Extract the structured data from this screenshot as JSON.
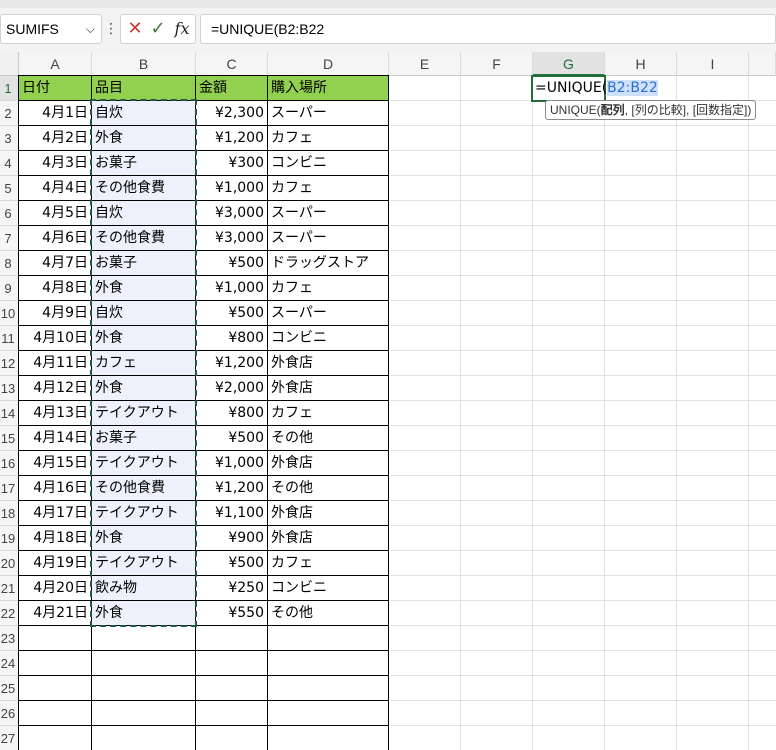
{
  "formula_bar": {
    "name_box": "SUMIFS",
    "name_box_dropdown_icon": "chevron-down-icon",
    "cancel_icon": "✕",
    "enter_icon": "✓",
    "fx_label": "fx",
    "formula": "=UNIQUE(B2:B22"
  },
  "columns": [
    "A",
    "B",
    "C",
    "D",
    "E",
    "F",
    "G",
    "H",
    "I"
  ],
  "active_column": "G",
  "rows": [
    "1",
    "2",
    "3",
    "4",
    "5",
    "6",
    "7",
    "8",
    "9",
    "10",
    "11",
    "12",
    "13",
    "14",
    "15",
    "16",
    "17",
    "18",
    "19",
    "20",
    "21",
    "22",
    "23",
    "24",
    "25",
    "26",
    "27"
  ],
  "active_row": "1",
  "table": {
    "headers": [
      "日付",
      "品目",
      "金額",
      "購入場所"
    ],
    "header_color": "#92d050",
    "rows": [
      [
        "4月1日",
        "自炊",
        "¥2,300",
        "スーパー"
      ],
      [
        "4月2日",
        "外食",
        "¥1,200",
        "カフェ"
      ],
      [
        "4月3日",
        "お菓子",
        "¥300",
        "コンビニ"
      ],
      [
        "4月4日",
        "その他食費",
        "¥1,000",
        "カフェ"
      ],
      [
        "4月5日",
        "自炊",
        "¥3,000",
        "スーパー"
      ],
      [
        "4月6日",
        "その他食費",
        "¥3,000",
        "スーパー"
      ],
      [
        "4月7日",
        "お菓子",
        "¥500",
        "ドラッグストア"
      ],
      [
        "4月8日",
        "外食",
        "¥1,000",
        "カフェ"
      ],
      [
        "4月9日",
        "自炊",
        "¥500",
        "スーパー"
      ],
      [
        "4月10日",
        "外食",
        "¥800",
        "コンビニ"
      ],
      [
        "4月11日",
        "カフェ",
        "¥1,200",
        "外食店"
      ],
      [
        "4月12日",
        "外食",
        "¥2,000",
        "外食店"
      ],
      [
        "4月13日",
        "テイクアウト",
        "¥800",
        "カフェ"
      ],
      [
        "4月14日",
        "お菓子",
        "¥500",
        "その他"
      ],
      [
        "4月15日",
        "テイクアウト",
        "¥1,000",
        "外食店"
      ],
      [
        "4月16日",
        "その他食費",
        "¥1,200",
        "その他"
      ],
      [
        "4月17日",
        "テイクアウト",
        "¥1,100",
        "外食店"
      ],
      [
        "4月18日",
        "外食",
        "¥900",
        "外食店"
      ],
      [
        "4月19日",
        "テイクアウト",
        "¥500",
        "カフェ"
      ],
      [
        "4月20日",
        "飲み物",
        "¥250",
        "コンビニ"
      ],
      [
        "4月21日",
        "外食",
        "¥550",
        "その他"
      ]
    ]
  },
  "active_cell": {
    "ref": "G1",
    "prefix": "=UNIQUE(",
    "range_ref": "B2:B22"
  },
  "tooltip": {
    "fn": "UNIQUE(",
    "arg1": "配列",
    "rest": ", [列の比較], [回数指定])"
  },
  "colors": {
    "selected_range_fill": "#eef1fb",
    "marching_ants": "#1e5a47",
    "active_border": "#1f6f3a",
    "reference_blue": "#2e6fd6"
  }
}
